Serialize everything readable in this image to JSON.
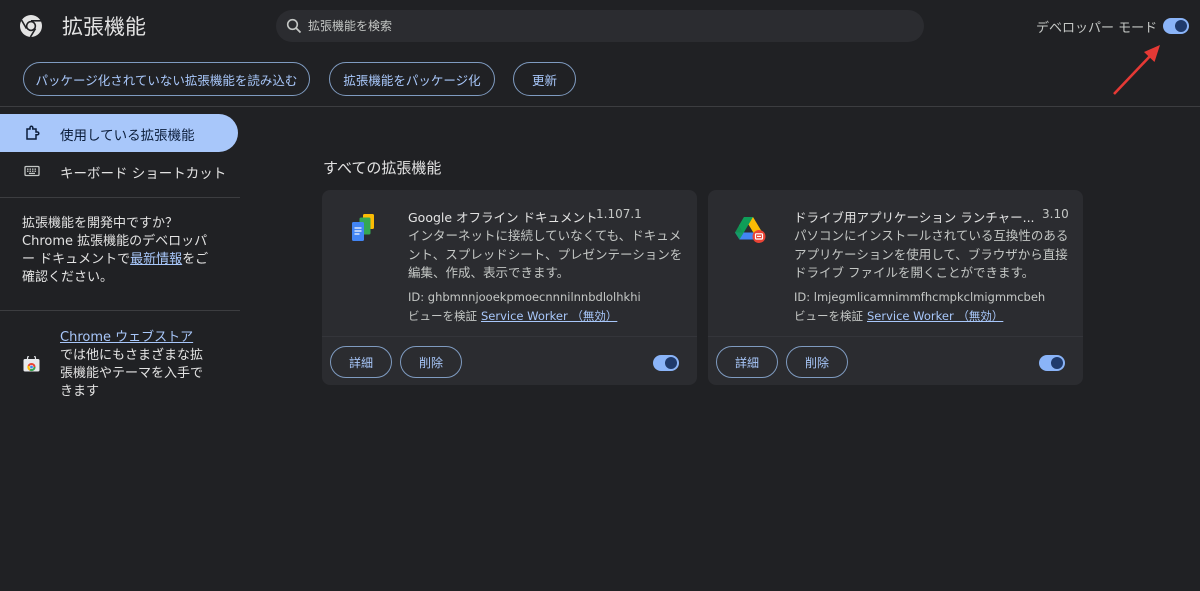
{
  "header": {
    "title": "拡張機能",
    "search_placeholder": "拡張機能を検索",
    "dev_mode_label": "デベロッパー モード",
    "dev_mode_on": true
  },
  "toolbar": {
    "load_unpacked": "パッケージ化されていない拡張機能を読み込む",
    "pack": "拡張機能をパッケージ化",
    "update": "更新"
  },
  "sidebar": {
    "items": [
      {
        "label": "使用している拡張機能",
        "icon": "puzzle-icon",
        "active": true
      },
      {
        "label": "キーボード ショートカット",
        "icon": "keyboard-icon",
        "active": false
      }
    ],
    "dev_text_before": "拡張機能を開発中ですか？Chrome 拡張機能のデベロッパー ドキュメントで",
    "dev_link": "最新情報",
    "dev_text_after": "をご確認ください。",
    "store_link": "Chrome ウェブストア",
    "store_text": " では他にもさまざまな拡張機能やテーマを入手できます"
  },
  "main": {
    "section_title": "すべての拡張機能",
    "extensions": [
      {
        "name": "Google オフライン ドキュメント",
        "version": "1.107.1",
        "description": "インターネットに接続していなくても、ドキュメント、スプレッドシート、プレゼンテーションを編集、作成、表示できます。",
        "id_text": "ID: ghbmnnjooekpmoecnnnilnnbdlolhkhi",
        "inspect_label": "ビューを検証",
        "inspect_link": "Service Worker （無効）",
        "details_label": "詳細",
        "remove_label": "削除",
        "enabled": true,
        "icon": "google-docs-offline-icon"
      },
      {
        "name": "ドライブ用アプリケーション ランチャー...",
        "version": "3.10",
        "description": "パソコンにインストールされている互換性のあるアプリケーションを使用して、ブラウザから直接ドライブ ファイルを開くことができます。",
        "id_text": "ID: lmjegmlicamnimmfhcmpkclmigmmcbeh",
        "inspect_label": "ビューを検証",
        "inspect_link": "Service Worker （無効）",
        "details_label": "詳細",
        "remove_label": "削除",
        "enabled": true,
        "icon": "drive-launcher-icon"
      }
    ]
  },
  "colors": {
    "background": "#202124",
    "card": "#2b2c30",
    "accent": "#a8c7fa",
    "annotation_arrow": "#e53935"
  }
}
